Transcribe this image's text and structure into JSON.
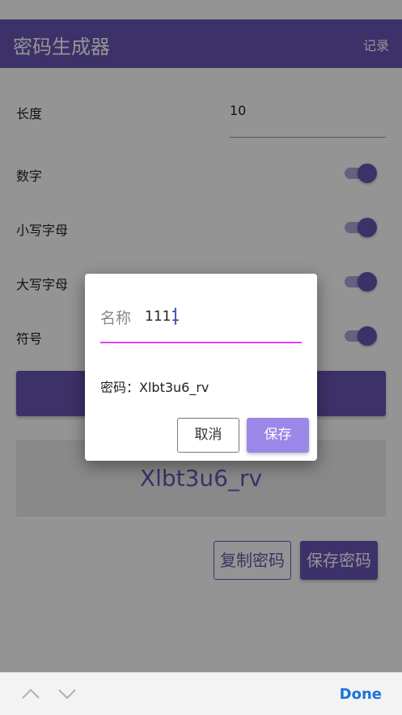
{
  "app": {
    "title": "密码生成器",
    "history_label": "记录"
  },
  "settings": {
    "length": {
      "label": "长度",
      "value": "10"
    },
    "toggles": [
      {
        "label": "数字",
        "on": true
      },
      {
        "label": "小写字母",
        "on": true
      },
      {
        "label": "大写字母",
        "on": true
      },
      {
        "label": "符号",
        "on": true
      }
    ]
  },
  "main": {
    "generate_label": "",
    "result_password": "Xlbt3u6_rv",
    "copy_label": "复制密码",
    "save_label": "保存密码"
  },
  "dialog": {
    "name_label": "名称",
    "name_value": "1111",
    "password_text": "密码：Xlbt3u6_rv",
    "cancel_label": "取消",
    "save_label": "保存"
  },
  "keyboard_toolbar": {
    "done_label": "Done",
    "prev_icon": "chevron-up-icon",
    "next_icon": "chevron-down-icon"
  },
  "colors": {
    "primary": "#6a55b5",
    "accent_underline": "#e040fb",
    "dialog_save": "#9b87e8",
    "done": "#1a73d9"
  }
}
